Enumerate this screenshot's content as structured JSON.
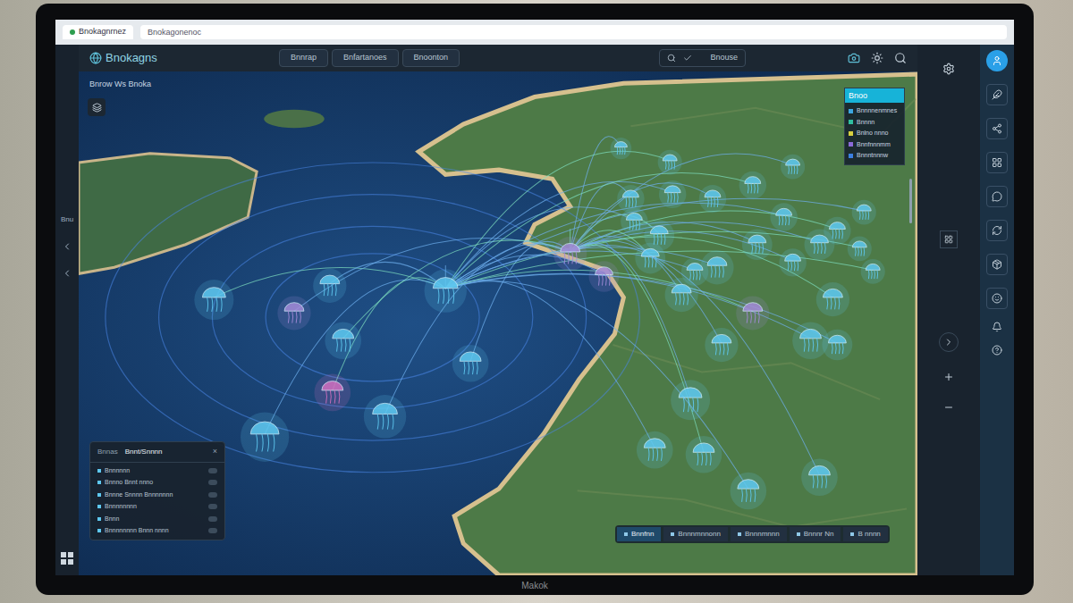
{
  "browser": {
    "tab": "Bnokagnrnez",
    "address": "Bnokagonenoc"
  },
  "header": {
    "logo": "Bnokagns",
    "nav": [
      "Bnnrap",
      "Bnfartanoes",
      "Bnoonton"
    ],
    "search": "Bnouse"
  },
  "map": {
    "subtitle": "Bnrow Ws Bnoka"
  },
  "legend": {
    "title": "Bnoo",
    "items": [
      {
        "label": "Bnnnnenmnes",
        "color": "#3ba6e0"
      },
      {
        "label": "Bnnnn",
        "color": "#2fbfa0"
      },
      {
        "label": "Bnlno nnno",
        "color": "#d7d040"
      },
      {
        "label": "Bnnfnnnmm",
        "color": "#8a6ad8"
      },
      {
        "label": "Bnnntnnnw",
        "color": "#3b7fe0"
      }
    ]
  },
  "panel": {
    "tabs": [
      {
        "label": "Bnnas",
        "selected": false
      },
      {
        "label": "Bnnt/Snnnn",
        "selected": true
      }
    ],
    "close": "×",
    "rows": [
      {
        "label": "Bnnnnnn",
        "checked": false
      },
      {
        "label": "Bnnno Bnnt nnno",
        "checked": false
      },
      {
        "label": "Bnnne Snnnn Bnnnnnnn",
        "checked": false
      },
      {
        "label": "Bnnnnnnnn",
        "checked": false
      },
      {
        "label": "Bnnn",
        "checked": false
      },
      {
        "label": "Bnnnnnnnn Bnnn nnnn",
        "checked": false
      }
    ]
  },
  "toolbar": [
    {
      "label": "Bnnfnn",
      "selected": true
    },
    {
      "label": "Bnnnmnnonn",
      "selected": false
    },
    {
      "label": "Bnnnmnnn",
      "selected": false
    },
    {
      "label": "Bnnnr Nn",
      "selected": false
    },
    {
      "label": "B nnnn",
      "selected": false
    }
  ],
  "left_rail": {
    "label": "Bnu"
  },
  "sidebar": {
    "items": [
      {
        "selected": true
      },
      {
        "selected": false
      },
      {
        "selected": false
      },
      {
        "selected": false
      },
      {
        "selected": false
      },
      {
        "selected": false
      },
      {
        "selected": false
      },
      {
        "selected": false
      }
    ]
  },
  "nodes": [
    {
      "color": "#5ec8f0"
    },
    {
      "color": "#a38bd8"
    },
    {
      "color": "#5ec8f0"
    },
    {
      "color": "#5ec8f0"
    },
    {
      "color": "#5ec8f0"
    },
    {
      "color": "#5ec8f0"
    },
    {
      "color": "#d070c0"
    },
    {
      "color": "#5ec8f0"
    },
    {
      "color": "#5ec8f0"
    },
    {
      "color": "#a38bd8"
    },
    {
      "color": "#a38bd8"
    },
    {
      "color": "#5ec8f0"
    },
    {
      "color": "#5ec8f0"
    },
    {
      "color": "#5ec8f0"
    },
    {
      "color": "#5ec8f0"
    },
    {
      "color": "#5ec8f0"
    },
    {
      "color": "#5ec8f0"
    },
    {
      "color": "#5ec8f0"
    },
    {
      "color": "#5ec8f0"
    },
    {
      "color": "#5ec8f0"
    },
    {
      "color": "#5ec8f0"
    },
    {
      "color": "#5ec8f0"
    },
    {
      "color": "#5ec8f0"
    },
    {
      "color": "#5ec8f0"
    },
    {
      "color": "#5ec8f0"
    },
    {
      "color": "#5ec8f0"
    },
    {
      "color": "#5ec8f0"
    },
    {
      "color": "#5ec8f0"
    },
    {
      "color": "#5ec8f0"
    },
    {
      "color": "#5ec8f0"
    },
    {
      "color": "#a38bd8"
    },
    {
      "color": "#5ec8f0"
    },
    {
      "color": "#5ec8f0"
    },
    {
      "color": "#5ec8f0"
    },
    {
      "color": "#5ec8f0"
    },
    {
      "color": "#5ec8f0"
    },
    {
      "color": "#5ec8f0"
    },
    {
      "color": "#5ec8f0"
    },
    {
      "color": "#5ec8f0"
    },
    {
      "color": "#5ec8f0"
    },
    {
      "color": "#5ec8f0"
    },
    {
      "color": "#5ec8f0"
    }
  ],
  "monitor": {
    "brand": "Makok"
  }
}
